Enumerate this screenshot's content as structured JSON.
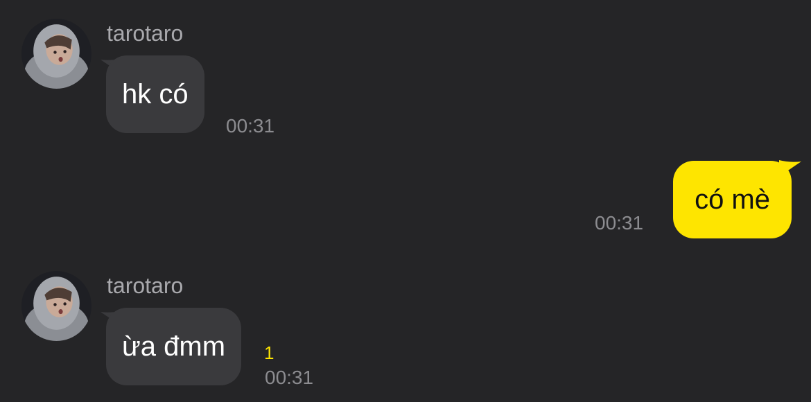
{
  "colors": {
    "background": "#252527",
    "incoming_bubble": "#3a3a3d",
    "outgoing_bubble": "#fee500",
    "unread_count": "#fee500"
  },
  "messages": [
    {
      "direction": "incoming",
      "sender": "tarotaro",
      "text": "hk có",
      "time": "00:31"
    },
    {
      "direction": "outgoing",
      "text": "có mè",
      "time": "00:31"
    },
    {
      "direction": "incoming",
      "sender": "tarotaro",
      "text": "ừa đmm",
      "unread": "1",
      "time": "00:31"
    }
  ]
}
